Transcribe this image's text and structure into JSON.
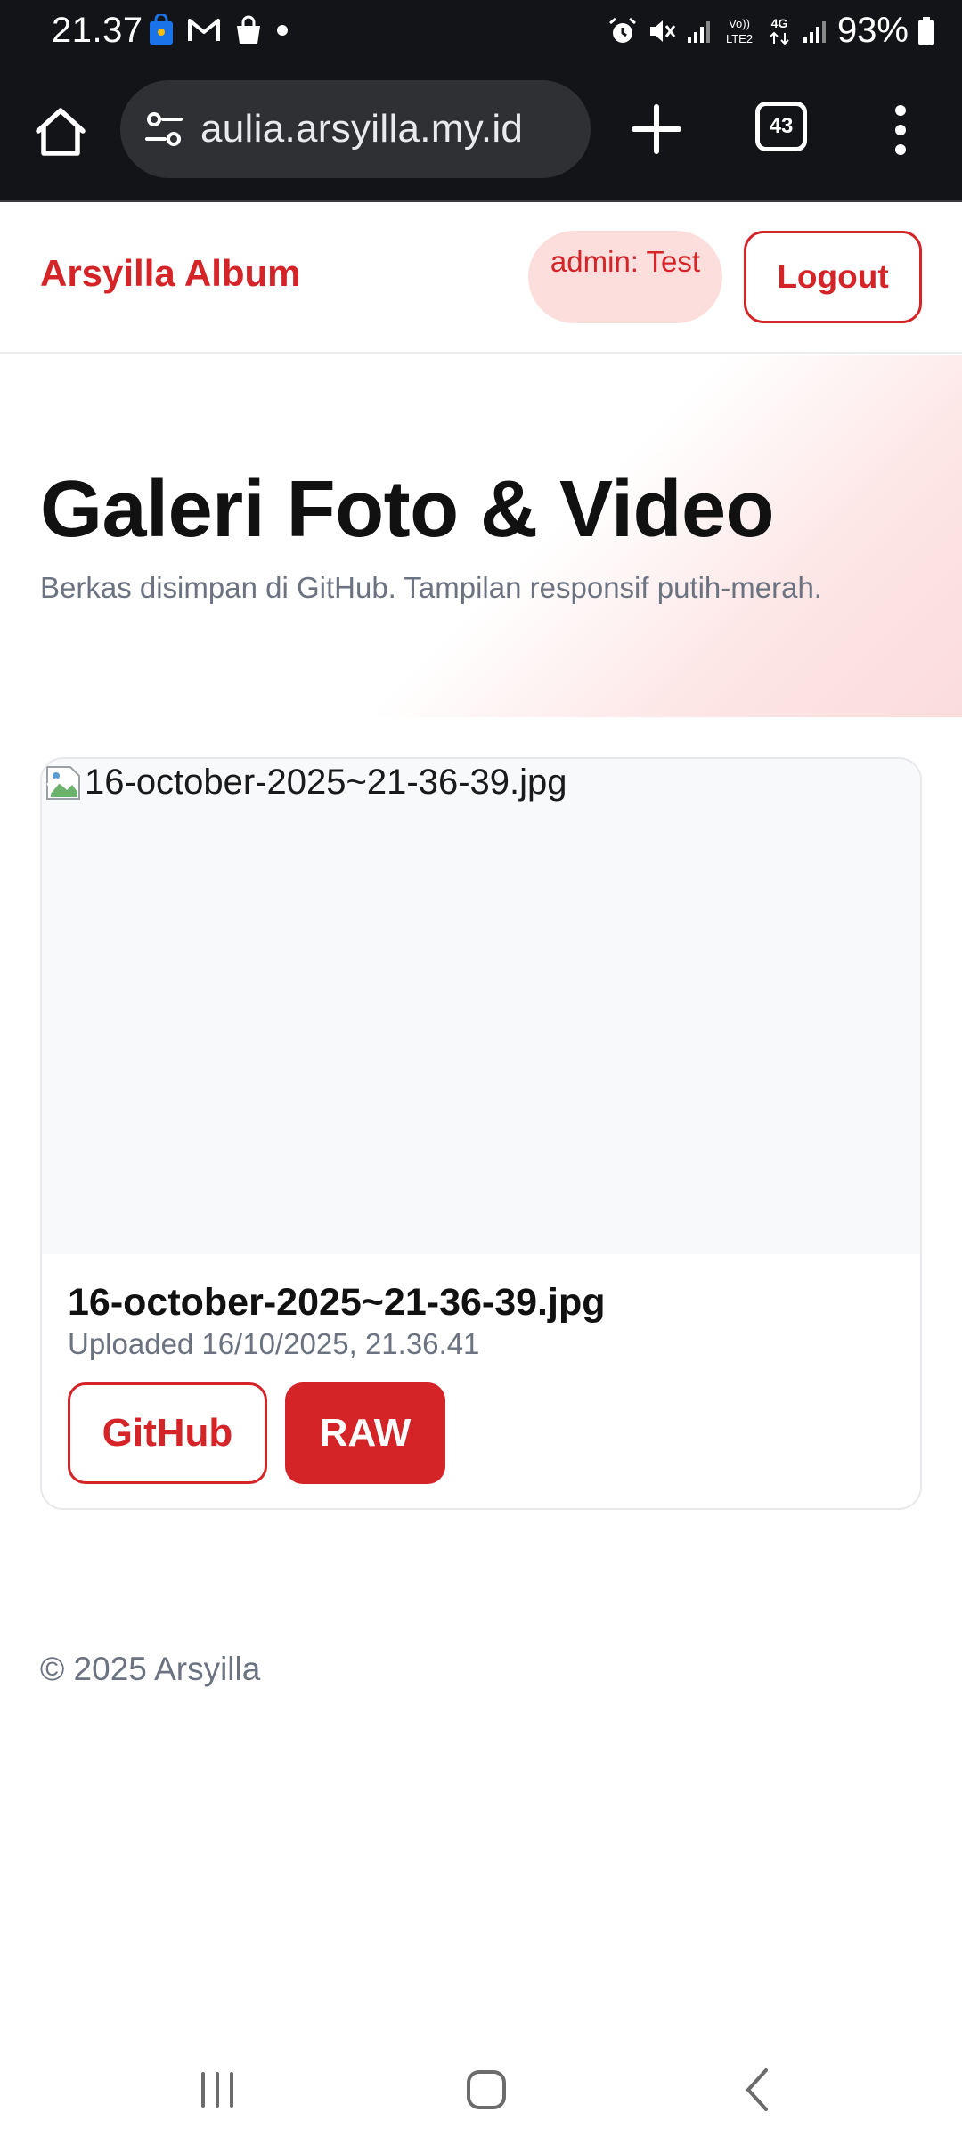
{
  "status_bar": {
    "time": "21.37",
    "battery": "93%",
    "left_icons": [
      "shopping-bag-app-icon",
      "gmail-icon",
      "shopping-bag-icon",
      "dot-icon"
    ],
    "right_icons": [
      "alarm-icon",
      "mute-icon",
      "signal-icon",
      "volte-icon",
      "4g-icon",
      "signal-icon",
      "battery-icon"
    ],
    "volte_label": "Vo) LTE2",
    "network_label": "4G"
  },
  "browser": {
    "url": "aulia.arsyilla.my.id",
    "tab_count": "43"
  },
  "header": {
    "brand": "Arsyilla Album",
    "admin_badge": "admin: Test",
    "logout_label": "Logout",
    "accent_color": "#d42428"
  },
  "hero": {
    "title": "Galeri Foto & Video",
    "subtitle": "Berkas disimpan di GitHub. Tampilan responsif putih-merah."
  },
  "gallery": {
    "items": [
      {
        "image_alt": "16-october-2025~21-36-39.jpg",
        "title": "16-october-2025~21-36-39.jpg",
        "uploaded": "Uploaded 16/10/2025, 21.36.41",
        "github_label": "GitHub",
        "raw_label": "RAW"
      }
    ]
  },
  "footer": {
    "text": "© 2025 Arsyilla"
  }
}
